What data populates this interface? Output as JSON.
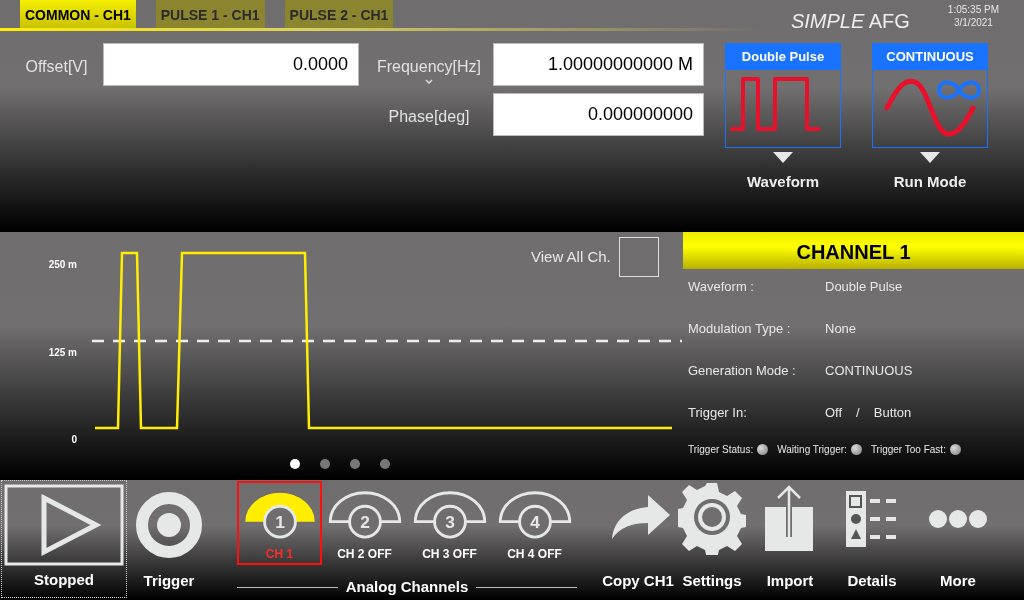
{
  "tabs": [
    {
      "label": "COMMON - CH1",
      "selected": true
    },
    {
      "label": "PULSE 1 - CH1",
      "selected": false
    },
    {
      "label": "PULSE 2 - CH1",
      "selected": false
    }
  ],
  "app_title": "*SIMPLE* AFG",
  "time": "1:05:35 PM",
  "date": "3/1/2021",
  "fields": [
    {
      "label": "Offset[V]",
      "value": "0.0000"
    },
    {
      "label": "Frequency[Hz]",
      "value": "1.00000000000 M",
      "expandable": true
    },
    {
      "label": "Phase[deg]",
      "value": "0.000000000"
    }
  ],
  "selectors": [
    {
      "kind": "waveform",
      "header": "Double Pulse",
      "label": "Waveform"
    },
    {
      "kind": "run_mode",
      "header": "CONTINUOUS",
      "label": "Run Mode"
    }
  ],
  "plot": {
    "y_labels": [
      "250 m",
      "125 m",
      "0"
    ],
    "view_all": {
      "label": "View All Ch.",
      "checked": false
    },
    "pages": [
      {
        "selected": true
      },
      {
        "selected": false
      },
      {
        "selected": false
      },
      {
        "selected": false
      }
    ]
  },
  "channel_panel": {
    "title": "CHANNEL 1",
    "rows": [
      {
        "label": "Waveform :",
        "values": [
          "Double Pulse"
        ]
      },
      {
        "label": "Modulation Type :",
        "values": [
          "None"
        ]
      },
      {
        "label": "Generation Mode :",
        "values": [
          "CONTINUOUS"
        ]
      },
      {
        "label": "Trigger In:",
        "values": [
          "Off",
          "/",
          "Button"
        ]
      }
    ],
    "indicators": [
      {
        "label": "Trigger Status:"
      },
      {
        "label": "Waiting Trigger:"
      },
      {
        "label": "Trigger Too Fast:"
      }
    ]
  },
  "toolbar": {
    "run_button": {
      "label": "Stopped"
    },
    "trigger_button": {
      "label": "Trigger"
    },
    "channel_group": {
      "label": "Analog Channels",
      "channels": [
        {
          "number": "1",
          "label": "CH 1",
          "on": true,
          "selected": true
        },
        {
          "number": "2",
          "label": "CH 2 OFF",
          "on": false,
          "selected": false
        },
        {
          "number": "3",
          "label": "CH 3 OFF",
          "on": false,
          "selected": false
        },
        {
          "number": "4",
          "label": "CH 4 OFF",
          "on": false,
          "selected": false
        }
      ]
    },
    "actions": [
      {
        "kind": "copy",
        "label": "Copy CH1"
      },
      {
        "kind": "settings",
        "label": "Settings"
      },
      {
        "kind": "import",
        "label": "Import"
      },
      {
        "kind": "details",
        "label": "Details"
      },
      {
        "kind": "more",
        "label": "More"
      }
    ]
  }
}
